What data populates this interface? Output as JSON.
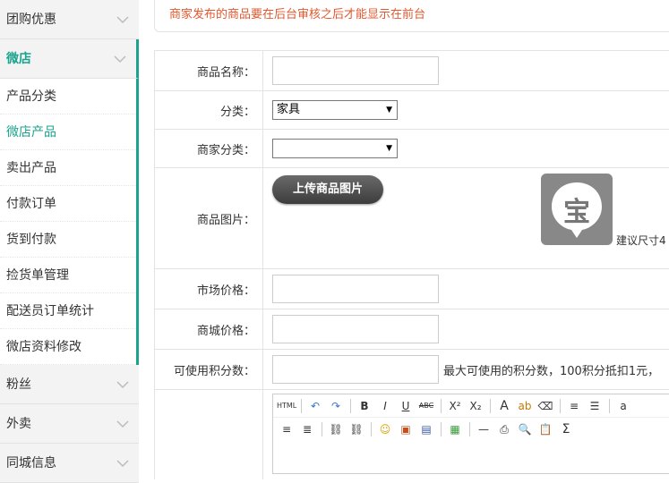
{
  "sidebar": {
    "sections_top": [
      {
        "label": "团购优惠"
      }
    ],
    "open_section": {
      "label": "微店"
    },
    "subitems": [
      {
        "label": "产品分类"
      },
      {
        "label": "微店产品"
      },
      {
        "label": "卖出产品"
      },
      {
        "label": "付款订单"
      },
      {
        "label": "货到付款"
      },
      {
        "label": "捡货单管理"
      },
      {
        "label": "配送员订单统计"
      },
      {
        "label": "微店资料修改"
      }
    ],
    "sections_bottom": [
      {
        "label": "粉丝"
      },
      {
        "label": "外卖"
      },
      {
        "label": "同城信息"
      }
    ]
  },
  "notice": "商家发布的商品要在后台审核之后才能显示在前台",
  "form": {
    "name_label": "商品名称：",
    "category_label": "分类：",
    "category_value": "家具",
    "merchant_category_label": "商家分类：",
    "merchant_category_value": "",
    "image_label": "商品图片：",
    "upload_button": "上传商品图片",
    "thumb_char": "宝",
    "size_tip": "建议尺寸4",
    "market_price_label": "市场价格：",
    "mall_price_label": "商城价格：",
    "points_label": "可使用积分数：",
    "points_tip": "最大可使用的积分数，100积分抵扣1元，"
  },
  "editor": {
    "row1": [
      "HTML",
      "↶",
      "↷",
      "B",
      "I",
      "U",
      "ABC",
      "X²",
      "X₂",
      "A",
      "ab",
      "⌫",
      "≡",
      "☰",
      "a"
    ],
    "row2": [
      "≡",
      "≣",
      "⛓",
      "⛓",
      "☺",
      "▣",
      "▤",
      "▦",
      "—",
      "⎙",
      "🔍",
      "📋",
      "Σ"
    ]
  }
}
